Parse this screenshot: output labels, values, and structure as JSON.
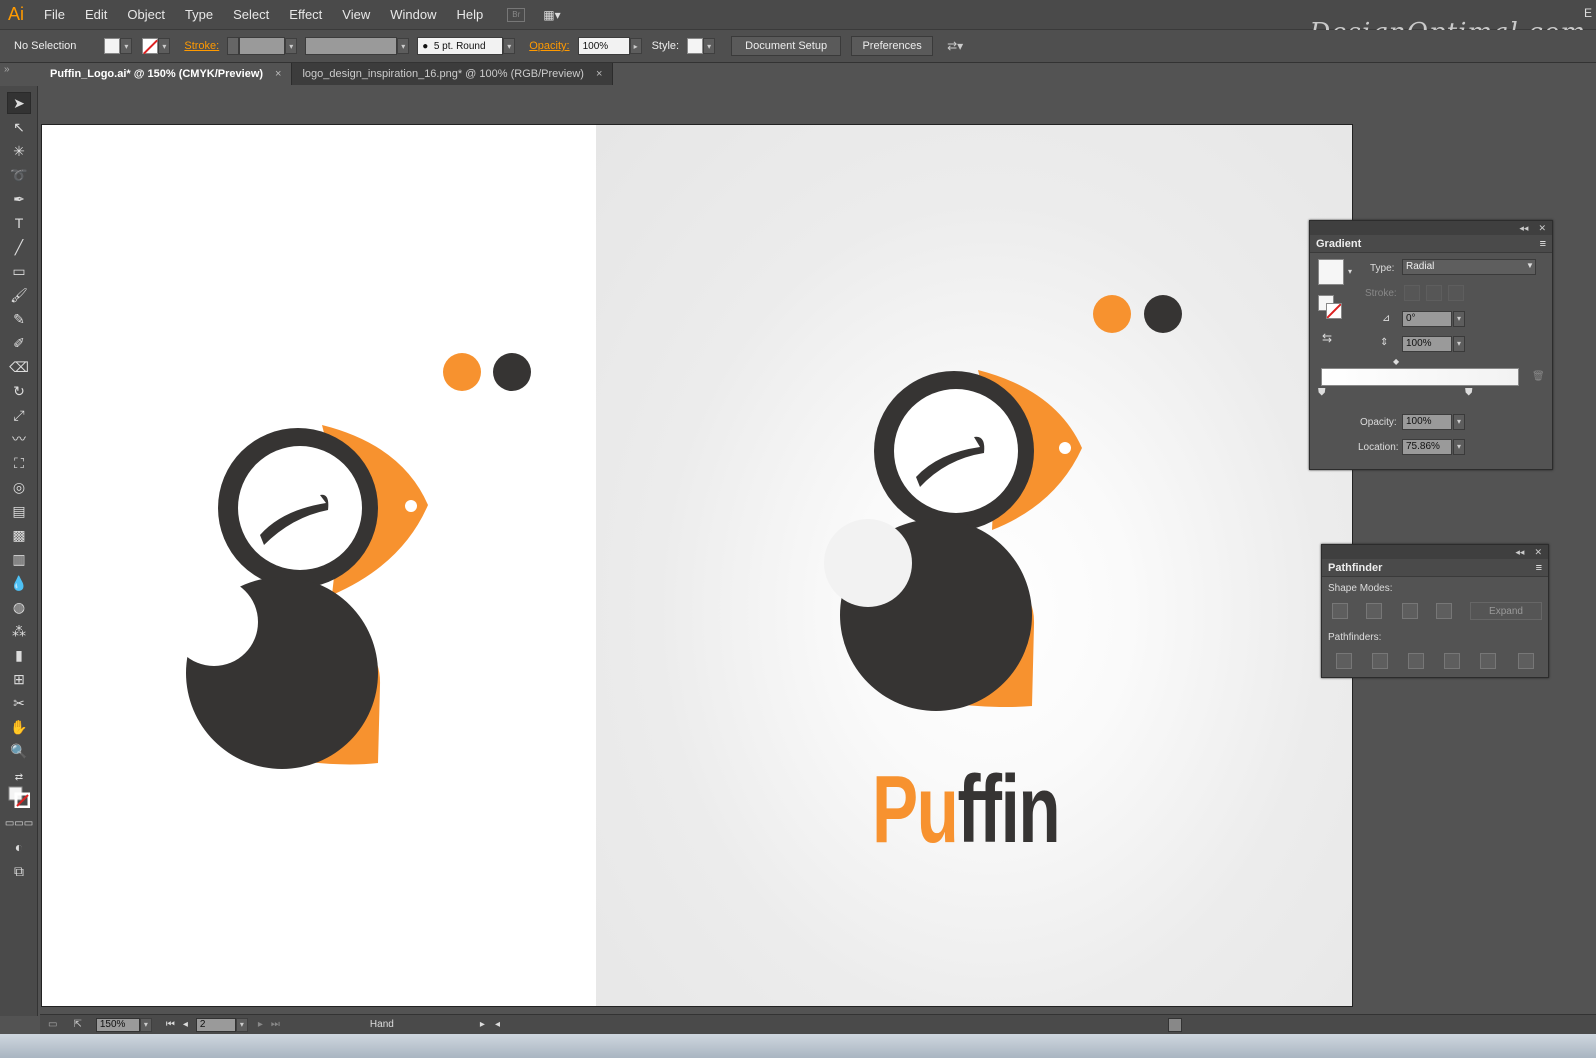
{
  "app": {
    "logo": "Ai",
    "watermark": "DesignOptimal.com",
    "corner_letter": "E"
  },
  "menu": [
    "File",
    "Edit",
    "Object",
    "Type",
    "Select",
    "Effect",
    "View",
    "Window",
    "Help"
  ],
  "bridge_button": "Br",
  "control": {
    "selection": "No Selection",
    "stroke_label": "Stroke:",
    "brush": "5 pt. Round",
    "opacity_label": "Opacity:",
    "opacity_value": "100%",
    "style_label": "Style:",
    "document_setup": "Document Setup",
    "preferences": "Preferences"
  },
  "tabs": [
    {
      "label": "Puffin_Logo.ai* @ 150% (CMYK/Preview)",
      "close": "×"
    },
    {
      "label": "logo_design_inspiration_16.png* @ 100% (RGB/Preview)",
      "close": "×"
    }
  ],
  "artboard": {
    "brand_part1": "Pu",
    "brand_part2": "ffin"
  },
  "colors": {
    "orange": "#f7922f",
    "dark": "#363433"
  },
  "gradient_panel": {
    "title": "Gradient",
    "type_label": "Type:",
    "type_value": "Radial",
    "stroke_label": "Stroke:",
    "angle_value": "0°",
    "aspect_value": "100%",
    "opacity_label": "Opacity:",
    "opacity_value": "100%",
    "location_label": "Location:",
    "location_value": "75.86%"
  },
  "pathfinder_panel": {
    "title": "Pathfinder",
    "shape_modes": "Shape Modes:",
    "expand": "Expand",
    "pathfinders": "Pathfinders:"
  },
  "status": {
    "zoom": "150%",
    "artboard": "2",
    "tool": "Hand"
  }
}
